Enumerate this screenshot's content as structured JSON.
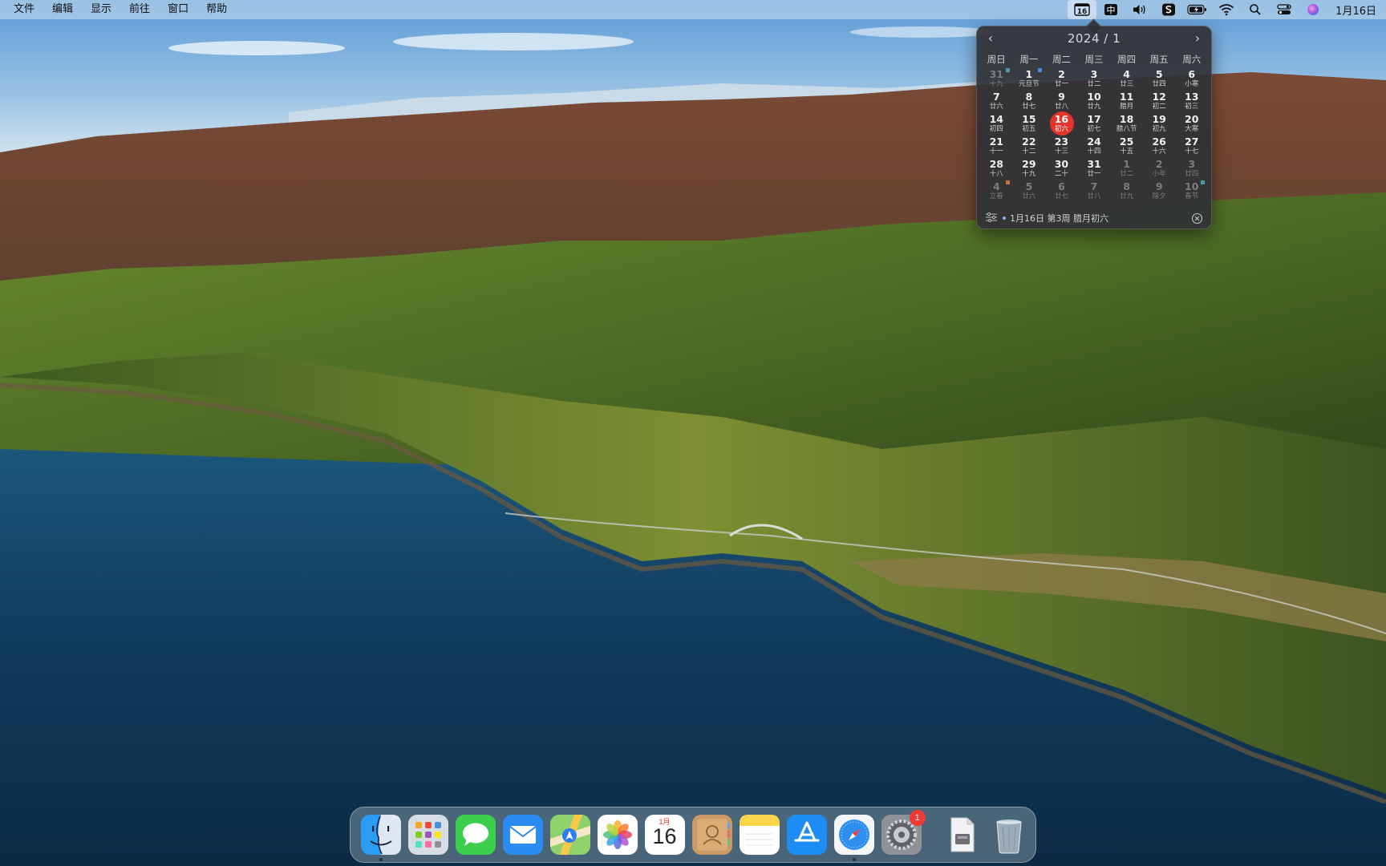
{
  "menubar": {
    "menus": [
      "文件",
      "编辑",
      "显示",
      "前往",
      "窗口",
      "帮助"
    ],
    "status_icons": [
      "calendar-status-icon",
      "input-method-icon",
      "volume-icon",
      "scrobble-app-icon",
      "battery-icon",
      "wifi-icon",
      "spotlight-icon",
      "control-center-icon",
      "siri-icon"
    ],
    "calendar_status_day": "16",
    "input_method_label": "中",
    "clock": "1月16日"
  },
  "calendar": {
    "title": "2024 / 1",
    "prev_label": "‹",
    "next_label": "›",
    "weekdays": [
      "周日",
      "周一",
      "周二",
      "周三",
      "周四",
      "周五",
      "周六"
    ],
    "weeks": [
      [
        {
          "d": "31",
          "l": "十九",
          "dim": true,
          "mark": "#4a9aa8"
        },
        {
          "d": "1",
          "l": "元旦节",
          "mark": "#4a8ad8"
        },
        {
          "d": "2",
          "l": "廿一"
        },
        {
          "d": "3",
          "l": "廿二"
        },
        {
          "d": "4",
          "l": "廿三"
        },
        {
          "d": "5",
          "l": "廿四"
        },
        {
          "d": "6",
          "l": "小寒"
        }
      ],
      [
        {
          "d": "7",
          "l": "廿六"
        },
        {
          "d": "8",
          "l": "廿七"
        },
        {
          "d": "9",
          "l": "廿八"
        },
        {
          "d": "10",
          "l": "廿九"
        },
        {
          "d": "11",
          "l": "腊月"
        },
        {
          "d": "12",
          "l": "初二"
        },
        {
          "d": "13",
          "l": "初三"
        }
      ],
      [
        {
          "d": "14",
          "l": "初四"
        },
        {
          "d": "15",
          "l": "初五"
        },
        {
          "d": "16",
          "l": "初六",
          "today": true
        },
        {
          "d": "17",
          "l": "初七"
        },
        {
          "d": "18",
          "l": "腊八节"
        },
        {
          "d": "19",
          "l": "初九"
        },
        {
          "d": "20",
          "l": "大寒"
        }
      ],
      [
        {
          "d": "21",
          "l": "十一"
        },
        {
          "d": "22",
          "l": "十二"
        },
        {
          "d": "23",
          "l": "十三"
        },
        {
          "d": "24",
          "l": "十四"
        },
        {
          "d": "25",
          "l": "十五"
        },
        {
          "d": "26",
          "l": "十六"
        },
        {
          "d": "27",
          "l": "十七"
        }
      ],
      [
        {
          "d": "28",
          "l": "十八"
        },
        {
          "d": "29",
          "l": "十九"
        },
        {
          "d": "30",
          "l": "二十"
        },
        {
          "d": "31",
          "l": "廿一"
        },
        {
          "d": "1",
          "l": "廿二",
          "dim": true
        },
        {
          "d": "2",
          "l": "小年",
          "dim": true
        },
        {
          "d": "3",
          "l": "廿四",
          "dim": true
        }
      ],
      [
        {
          "d": "4",
          "l": "立春",
          "dim": true,
          "mark": "#c07040"
        },
        {
          "d": "5",
          "l": "廿六",
          "dim": true
        },
        {
          "d": "6",
          "l": "廿七",
          "dim": true
        },
        {
          "d": "7",
          "l": "廿八",
          "dim": true
        },
        {
          "d": "8",
          "l": "廿九",
          "dim": true
        },
        {
          "d": "9",
          "l": "除夕",
          "dim": true
        },
        {
          "d": "10",
          "l": "春节",
          "dim": true,
          "mark": "#4a9aa8"
        }
      ]
    ],
    "footer_text": "1月16日 第3周 腊月初六"
  },
  "dock": {
    "apps": [
      {
        "name": "finder-icon",
        "running": true
      },
      {
        "name": "launchpad-icon"
      },
      {
        "name": "messages-icon"
      },
      {
        "name": "mail-icon"
      },
      {
        "name": "maps-icon"
      },
      {
        "name": "photos-icon"
      },
      {
        "name": "calendar-app-icon"
      },
      {
        "name": "contacts-icon"
      },
      {
        "name": "notes-icon"
      },
      {
        "name": "app-store-icon"
      },
      {
        "name": "safari-icon",
        "running": true
      },
      {
        "name": "system-preferences-icon",
        "badge": "1"
      }
    ],
    "calendar_app_month": "1月",
    "calendar_app_day": "16",
    "others": [
      "downloads-stack-icon",
      "trash-icon"
    ]
  },
  "colors": {
    "today": "#e5342b",
    "popover_bg": "#303236",
    "badge": "#ef3b33"
  }
}
